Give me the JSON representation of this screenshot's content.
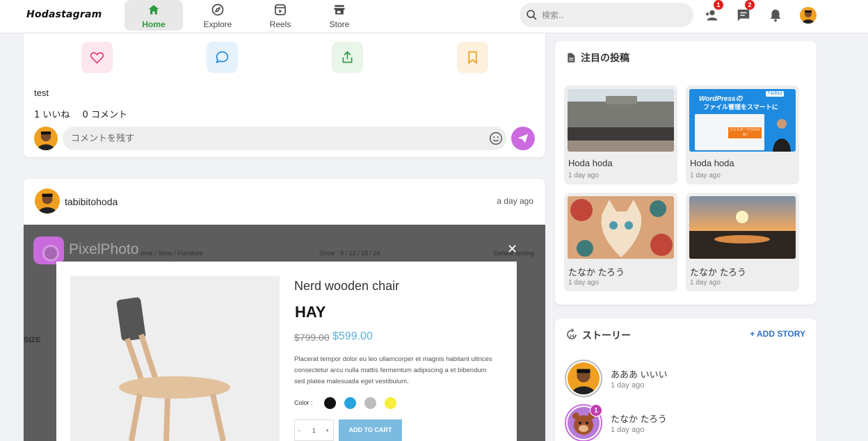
{
  "app": {
    "logo": "Hodastagram"
  },
  "nav": [
    {
      "label": "Home",
      "icon": "home-icon",
      "active": true
    },
    {
      "label": "Explore",
      "icon": "compass-icon"
    },
    {
      "label": "Reels",
      "icon": "reels-icon"
    },
    {
      "label": "Store",
      "icon": "store-icon"
    }
  ],
  "search": {
    "placeholder": "検索.."
  },
  "header_icons": {
    "friend_requests_badge": "1",
    "messages_badge": "2"
  },
  "post1": {
    "caption": "test",
    "likes": "1 いいね",
    "comments": "0 コメント",
    "comment_placeholder": "コメントを残す"
  },
  "post2": {
    "username": "tabibitohoda",
    "time": "a day ago",
    "image": {
      "brand": "PixelPhoto",
      "breadcrumb": "ome / Shop / Furniture",
      "show": "Show : 9 / 12 / 18 / 24",
      "sorting": "Default sorting",
      "size_label": "SIZE",
      "product_title": "Nerd wooden chair",
      "product_brand": "HAY",
      "price_old": "$799.00",
      "price_new": "$599.00",
      "description": "Placerat tempor dolor eu leo ullamcorper et magnis habitant ultrices consectetur arcu nulla mattis fermentum adipiscing a et bibendum sed platea malesuada eget vestibulum.",
      "color_label": "Color :",
      "swatches": [
        "#111111",
        "#29a3e0",
        "#bdbdbd",
        "#f5ee3a"
      ],
      "qty_minus": "-",
      "qty_value": "1",
      "qty_plus": "+",
      "add_to_cart": "ADD TO CART"
    }
  },
  "trending": {
    "title": "注目の投稿",
    "items": [
      {
        "name": "Hoda hoda",
        "time": "1 day ago"
      },
      {
        "name": "Hoda hoda",
        "time": "1 day ago",
        "thumb_text_1": "WordPressの",
        "thumb_text_2": "ファイル管理をスマートに",
        "thumb_badge": "FileBird",
        "thumb_callout": "フォルダーで分けれる!!"
      },
      {
        "name": "たなか たろう",
        "time": "1 day ago"
      },
      {
        "name": "たなか たろう",
        "time": "1 day ago"
      }
    ]
  },
  "stories": {
    "title": "ストーリー",
    "add_label": "ADD STORY",
    "items": [
      {
        "name": "あああ いいい",
        "time": "1 day ago"
      },
      {
        "name": "たなか たろう",
        "time": "1 day ago",
        "badge": "1"
      }
    ]
  }
}
